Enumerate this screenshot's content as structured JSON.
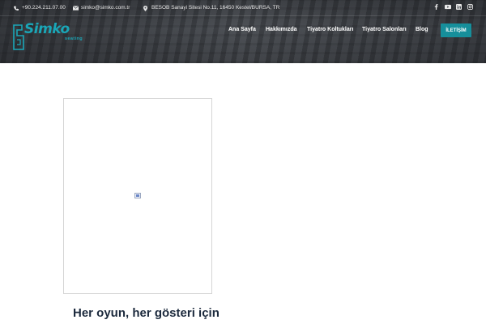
{
  "topbar": {
    "phone": "+90.224.211.07.00",
    "email": "simko@simko.com.tr",
    "address": "BESOB Sanayi Sitesi No.11, 16450 Kestel/BURSA, TR",
    "social_icons": [
      "facebook-icon",
      "youtube-icon",
      "linkedin-icon",
      "instagram-icon"
    ]
  },
  "logo": {
    "name": "Simko",
    "tagline": "seating"
  },
  "nav": {
    "items": [
      "Ana Sayfa",
      "Hakkımızda",
      "Tiyatro Koltukları",
      "Tiyatro Salonları",
      "Blog"
    ],
    "cta": "İLETİŞİM"
  },
  "content": {
    "headline": "Her oyun, her gösteri için"
  },
  "colors": {
    "brand": "#1aa6b7",
    "cta": "#168f9b",
    "headline": "#1c2a3d"
  }
}
